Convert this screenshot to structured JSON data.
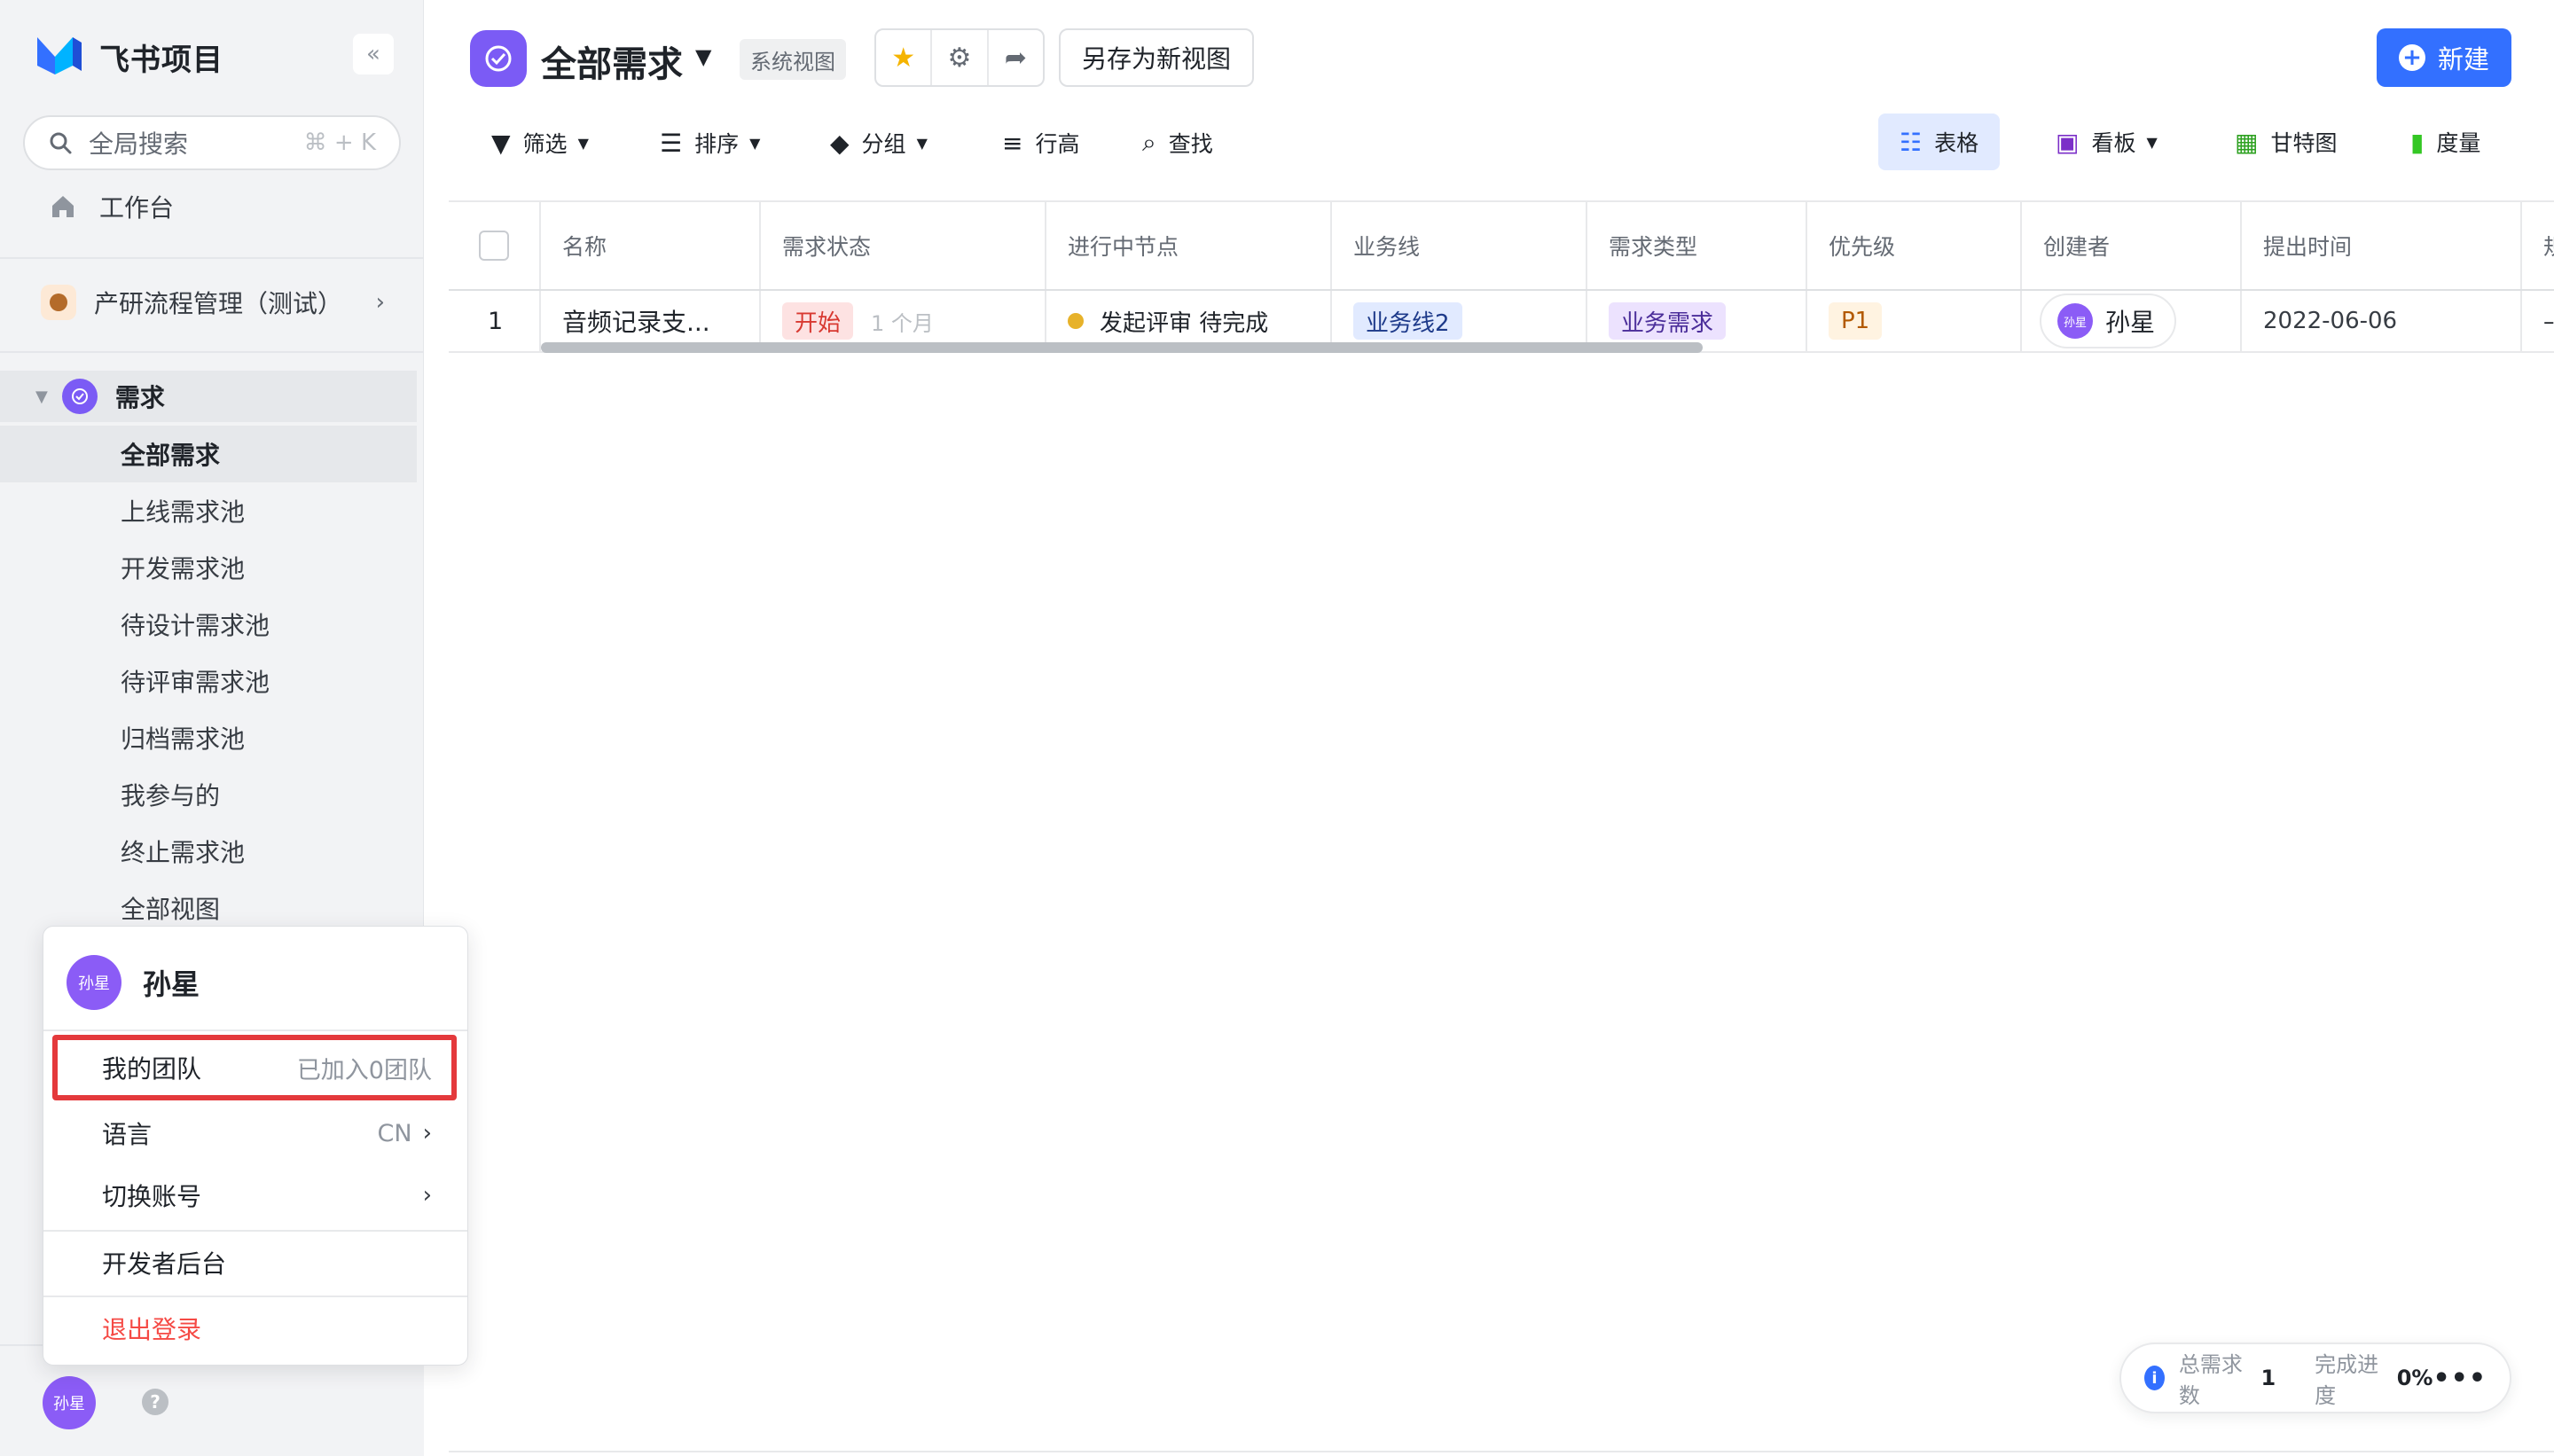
{
  "app": {
    "name": "飞书项目",
    "collapse_icon": "«"
  },
  "search": {
    "label": "全局搜索",
    "shortcut": "⌘ + K"
  },
  "sidebar": {
    "workbench": "工作台",
    "space": "产研流程管理（测试）",
    "section": "需求",
    "items": [
      "全部需求",
      "上线需求池",
      "开发需求池",
      "待设计需求池",
      "待评审需求池",
      "归档需求池",
      "我参与的",
      "终止需求池",
      "全部视图"
    ]
  },
  "user": {
    "avatar_text": "孙星",
    "name": "孙星"
  },
  "popup": {
    "team": {
      "label": "我的团队",
      "value": "已加入0团队"
    },
    "language": {
      "label": "语言",
      "value": "CN"
    },
    "switch_account": "切换账号",
    "developer": "开发者后台",
    "logout": "退出登录"
  },
  "header": {
    "title": "全部需求",
    "tag": "系统视图",
    "save_view": "另存为新视图",
    "new_button": "新建"
  },
  "toolbar": {
    "filter": "筛选",
    "sort": "排序",
    "group": "分组",
    "row_height": "行高",
    "find": "查找"
  },
  "views": {
    "table": "表格",
    "board": "看板",
    "gantt": "甘特图",
    "metrics": "度量"
  },
  "table": {
    "columns": [
      "名称",
      "需求状态",
      "进行中节点",
      "业务线",
      "需求类型",
      "优先级",
      "创建者",
      "提出时间",
      "规"
    ],
    "rows": [
      {
        "index": "1",
        "name": "音频记录支...",
        "status": "开始",
        "status_age": "1 个月",
        "node": "发起评审 待完成",
        "business_line": "业务线2",
        "type": "业务需求",
        "priority": "P1",
        "creator_avatar": "孙星",
        "creator": "孙星",
        "date": "2022-06-06",
        "extra": "–"
      }
    ]
  },
  "stats": {
    "total_label": "总需求数",
    "total": "1",
    "progress_label": "完成进度",
    "progress": "0%"
  },
  "colors": {
    "primary": "#3370ff",
    "brand_purple": "#7b5bf5",
    "danger": "#f54a45",
    "highlight": "#e4393c"
  }
}
